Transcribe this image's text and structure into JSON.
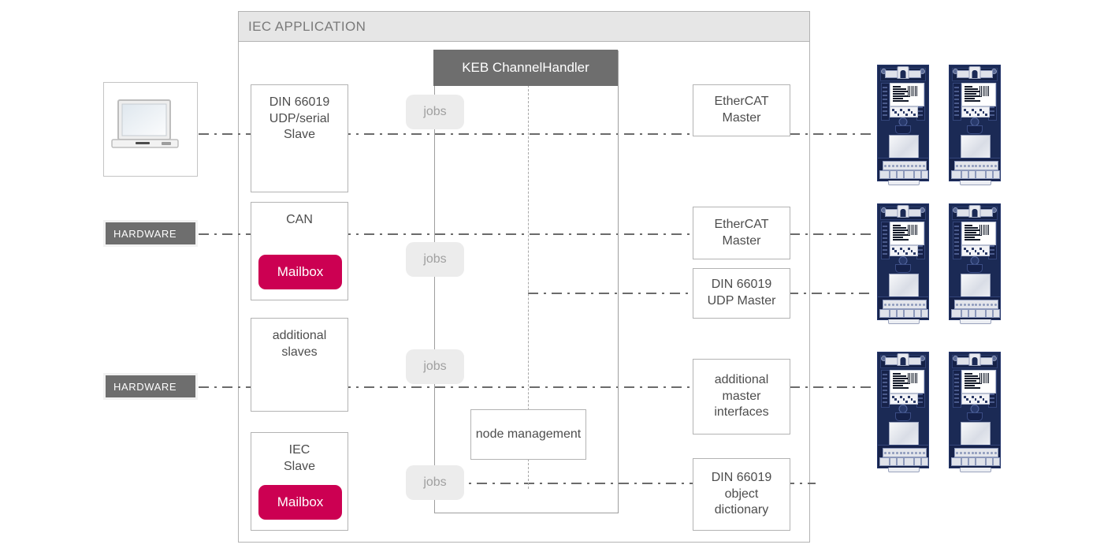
{
  "application": {
    "title": "IEC APPLICATION"
  },
  "channel_handler": {
    "title": "KEB ChannelHandler",
    "node_management": "node management",
    "jobs_label": "jobs",
    "jobs_pills": [
      {
        "label": "jobs"
      },
      {
        "label": "jobs"
      },
      {
        "label": "jobs"
      },
      {
        "label": "jobs"
      }
    ]
  },
  "slaves": [
    {
      "id": "din-66019-udp-serial-slave",
      "lines": [
        "DIN 66019",
        "UDP/serial",
        "Slave"
      ],
      "mailbox": null
    },
    {
      "id": "can-slave",
      "lines": [
        "CAN"
      ],
      "mailbox": "Mailbox"
    },
    {
      "id": "additional-slaves",
      "lines": [
        "additional",
        "slaves"
      ],
      "mailbox": null
    },
    {
      "id": "iec-slave",
      "lines": [
        "IEC",
        "Slave"
      ],
      "mailbox": "Mailbox"
    }
  ],
  "masters": [
    {
      "id": "ethercat-master-1",
      "lines": [
        "EtherCAT",
        "Master"
      ]
    },
    {
      "id": "ethercat-master-2",
      "lines": [
        "EtherCAT",
        "Master"
      ]
    },
    {
      "id": "din-66019-udp-master",
      "lines": [
        "DIN 66019",
        "UDP Master"
      ]
    },
    {
      "id": "additional-master-interfaces",
      "lines": [
        "additional",
        "master",
        "interfaces"
      ]
    },
    {
      "id": "din-66019-object-dictionary",
      "lines": [
        "DIN 66019",
        "object",
        "dictionary"
      ]
    }
  ],
  "hardware_tags": [
    {
      "label": "HARDWARE"
    },
    {
      "label": "HARDWARE"
    }
  ],
  "endpoints": {
    "laptop": "laptop-icon",
    "devices": [
      {
        "id": "keb-drive-1"
      },
      {
        "id": "keb-drive-2"
      },
      {
        "id": "keb-drive-3"
      },
      {
        "id": "keb-drive-4"
      },
      {
        "id": "keb-drive-5"
      },
      {
        "id": "keb-drive-6"
      }
    ]
  },
  "colors": {
    "mailbox": "#cc0052",
    "header_bar": "#6e6e6e",
    "app_title_bg": "#e6e6e6",
    "box_border": "#b3b3b3",
    "text": "#4d4d4d",
    "jobs_bg": "#ececec",
    "jobs_text": "#a0a0a0",
    "device_body": "#1b2a55",
    "device_brand": "#d6004f"
  }
}
